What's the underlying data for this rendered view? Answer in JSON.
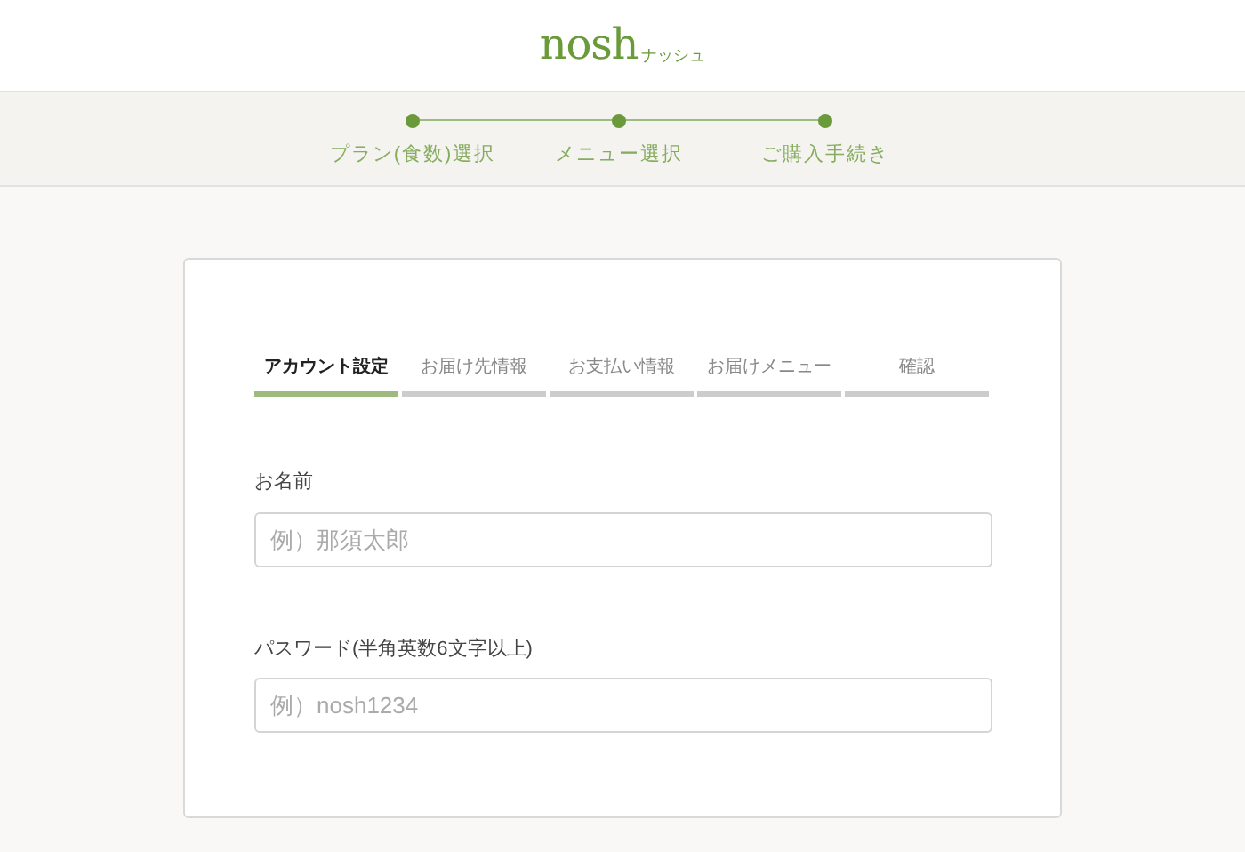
{
  "logo": {
    "wordmark": "nosh",
    "kana": "ナッシュ"
  },
  "steps": [
    {
      "label": "プラン(食数)選択",
      "completed": true
    },
    {
      "label": "メニュー選択",
      "completed": true
    },
    {
      "label": "ご購入手続き",
      "completed": true
    }
  ],
  "tabs": [
    {
      "label": "アカウント設定",
      "selected": true
    },
    {
      "label": "お届け先情報",
      "selected": false
    },
    {
      "label": "お支払い情報",
      "selected": false
    },
    {
      "label": "お届けメニュー",
      "selected": false
    },
    {
      "label": "確認",
      "selected": false
    }
  ],
  "fields": [
    {
      "label": "お名前",
      "placeholder": "例）那須太郎"
    },
    {
      "label": "パスワード(半角英数6文字以上)",
      "placeholder": "例）nosh1234"
    }
  ]
}
